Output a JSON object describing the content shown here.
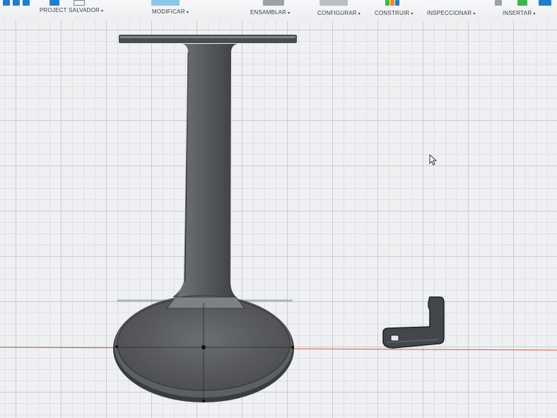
{
  "toolbar": {
    "menus": {
      "project_save": "PROJECT SALVADOR",
      "modify": "MODIFICAR",
      "assemble": "ENSAMBLAR",
      "configure": "CONFIGURAR",
      "construct": "CONSTRUIR",
      "inspect": "INSPECCIONAR",
      "insert": "INSERTAR"
    },
    "caret": "▾"
  },
  "colors": {
    "accent_blue": "#1f7ecb",
    "x_axis_red": "#d9534f",
    "green": "#3bb54a",
    "orange": "#f08a24",
    "model_gray": "#5a5d61",
    "model_dark": "#3b3d40"
  },
  "icons": [
    "save-icon",
    "modify-icon",
    "construct-icon",
    "insert-icon",
    "cursor-icon"
  ]
}
